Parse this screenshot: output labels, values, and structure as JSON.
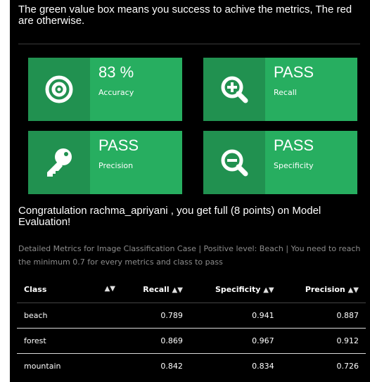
{
  "intro": "The green value box means you success to achive the metrics, The red are otherwise.",
  "boxes": [
    {
      "value": "83 %",
      "label": "Accuracy",
      "icon": "target-icon"
    },
    {
      "value": "PASS",
      "label": "Recall",
      "icon": "zoom-in-icon"
    },
    {
      "value": "PASS",
      "label": "Precision",
      "icon": "key-icon"
    },
    {
      "value": "PASS",
      "label": "Specificity",
      "icon": "zoom-out-icon"
    }
  ],
  "congrats": "Congratulation rachma_apriyani , you get full (8 points) on Model Evaluation!",
  "detail": "Detailed Metrics for Image Classification Case | Positive level: Beach | You need to reach the minimum 0.7 for every metrics and class to pass",
  "table": {
    "headers": [
      "Class",
      "Recall",
      "Specificity",
      "Precision"
    ],
    "rows": [
      [
        "beach",
        "0.789",
        "0.941",
        "0.887"
      ],
      [
        "forest",
        "0.869",
        "0.967",
        "0.912"
      ],
      [
        "mountain",
        "0.842",
        "0.834",
        "0.726"
      ]
    ]
  },
  "colors": {
    "pass_box": "#27ae60",
    "pass_icon_bg": "#219150",
    "panel_bg": "#000000"
  },
  "sort_glyph": "▲▼"
}
